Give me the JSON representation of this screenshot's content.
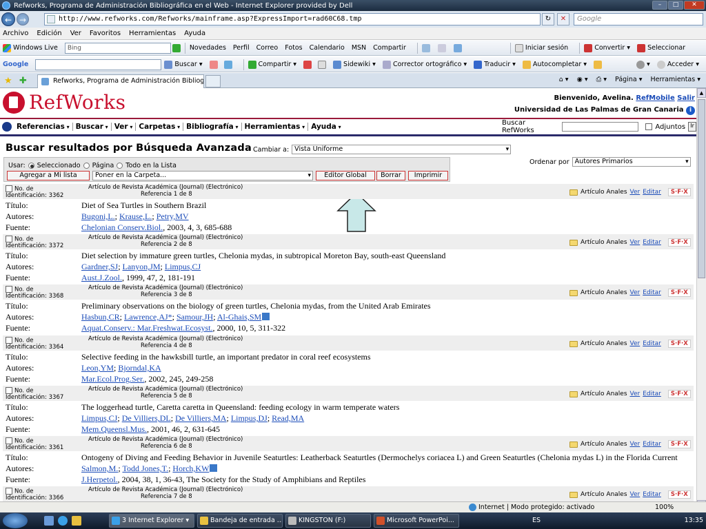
{
  "browser": {
    "title": "Refworks, Programa de Administración Bibliográfica en el Web - Internet Explorer provided by Dell",
    "url": "http://www.refworks.com/Refworks/mainframe.asp?ExpressImport=rad60C68.tmp",
    "search_placeholder": "Google",
    "menu": [
      "Archivo",
      "Edición",
      "Ver",
      "Favoritos",
      "Herramientas",
      "Ayuda"
    ],
    "toolbar1": {
      "windows_live": "Windows Live",
      "bing_value": "Bing",
      "links": [
        "Novedades",
        "Perfil",
        "Correo",
        "Fotos",
        "Calendario",
        "MSN",
        "Compartir"
      ],
      "iniciar": "Iniciar sesión",
      "convertir": "Convertir",
      "seleccionar": "Seleccionar"
    },
    "toolbar2": {
      "google": "Google",
      "buscar": "Buscar",
      "compartir": "Compartir",
      "sidewiki": "Sidewiki",
      "corrector": "Corrector ortográfico",
      "traducir": "Traducir",
      "autocompletar": "Autocompletar",
      "acceder": "Acceder"
    },
    "tab_title": "Refworks, Programa de Administración Bibliográf...",
    "tab_tools": {
      "pagina": "Página",
      "herramientas": "Herramientas"
    }
  },
  "app": {
    "logo": "RefWorks",
    "welcome": "Bienvenido, Avelina.",
    "refmobile": "RefMobile",
    "salir": "Salir",
    "university": "Universidad de Las Palmas de Gran Canaria",
    "menu": [
      "Referencias",
      "Buscar",
      "Ver",
      "Carpetas",
      "Bibliografía",
      "Herramientas",
      "Ayuda"
    ],
    "search_label": "Buscar RefWorks",
    "adjuntos": "Adjuntos",
    "heading": "Buscar resultados por Búsqueda Avanzada",
    "cambiar_label": "Cambiar a:",
    "cambiar_value": "Vista Uniforme",
    "usar_label": "Usar:",
    "usar_options": [
      "Seleccionado",
      "Página",
      "Todo en la Lista"
    ],
    "btn_agregar": "Agregar a Mi lista",
    "carpeta_select": "Poner en la Carpeta...",
    "btn_editor": "Editor Global",
    "btn_borrar": "Borrar",
    "btn_imprimir": "Imprimir",
    "ordenar_label": "Ordenar por",
    "ordenar_value": "Autores Primarios",
    "labels": {
      "titulo": "Título:",
      "autores": "Autores:",
      "fuente": "Fuente:"
    },
    "folder_label": "Artículo Anales",
    "ver": "Ver",
    "editar": "Editar",
    "sfx": "S·F·X"
  },
  "records": [
    {
      "id_label": "No. de Identificación: 3362",
      "type": "Artículo de Revista Académica (Journal) (Electrónico)",
      "ref": "Referencia 1 de 8",
      "title": "Diet of Sea Turtles in Southern Brazil",
      "authors": [
        "Bugoni,L.",
        "Krause,L.",
        "Petry,MV"
      ],
      "source_link": "Chelonian Conserv.Biol.",
      "source_rest": ", 2003, 4, 3, 685-688"
    },
    {
      "id_label": "No. de Identificación: 3372",
      "type": "Artículo de Revista Académica (Journal) (Electrónico)",
      "ref": "Referencia 2 de 8",
      "title": "Diet selection by immature green turtles, Chelonia mydas, in subtropical Moreton Bay, south-east Queensland",
      "authors": [
        "Gardner,SJ",
        "Lanyon,JM",
        "Limpus,CJ"
      ],
      "source_link": "Aust.J.Zool.",
      "source_rest": ", 1999, 47, 2, 181-191"
    },
    {
      "id_label": "No. de Identificación: 3368",
      "type": "Artículo de Revista Académica (Journal) (Electrónico)",
      "ref": "Referencia 3 de 8",
      "title": "Preliminary observations on the biology of green turtles, Chelonia mydas, from the United Arab Emirates",
      "authors": [
        "Hasbun,CR",
        "Lawrence,AJ*",
        "Samour,JH",
        "Al-Ghais,SM"
      ],
      "source_link": "Aquat.Conserv.: Mar.Freshwat.Ecosyst.",
      "source_rest": ", 2000, 10, 5, 311-322"
    },
    {
      "id_label": "No. de Identificación: 3364",
      "type": "Artículo de Revista Académica (Journal) (Electrónico)",
      "ref": "Referencia 4 de 8",
      "title": "Selective feeding in the hawksbill turtle, an important predator in coral reef ecosystems",
      "authors": [
        "Leon,YM",
        "Bjorndal,KA"
      ],
      "source_link": "Mar.Ecol.Prog.Ser.",
      "source_rest": ", 2002, 245, 249-258"
    },
    {
      "id_label": "No. de Identificación: 3367",
      "type": "Artículo de Revista Académica (Journal) (Electrónico)",
      "ref": "Referencia 5 de 8",
      "title": "The loggerhead turtle, Caretta caretta in Queensland: feeding ecology in warm temperate waters",
      "authors": [
        "Limpus,CJ",
        "De Villiers,DL",
        "De Villiers,MA",
        "Limpus,DJ",
        "Read,MA"
      ],
      "source_link": "Mem.Queensl.Mus.",
      "source_rest": ", 2001, 46, 2, 631-645"
    },
    {
      "id_label": "No. de Identificación: 3361",
      "type": "Artículo de Revista Académica (Journal) (Electrónico)",
      "ref": "Referencia 6 de 8",
      "title": "Ontogeny of Diving and Feeding Behavior in Juvenile Seaturtles: Leatherback Seaturtles (Dermochelys coriacea L) and Green Seaturtles (Chelonia mydas L) in the Florida Current",
      "authors": [
        "Salmon,M.",
        "Todd Jones,T.",
        "Horch,KW"
      ],
      "source_link": "J.Herpetol.",
      "source_rest": ", 2004, 38, 1, 36-43, The Society for the Study of Amphibians and Reptiles"
    },
    {
      "id_label": "No. de Identificación: 3366",
      "type": "Artículo de Revista Académica (Journal) (Electrónico)",
      "ref": "Referencia 7 de 8"
    }
  ],
  "status": {
    "zone": "Internet | Modo protegido: activado",
    "zoom": "100%"
  },
  "taskbar": {
    "items": [
      "3 Internet Explorer",
      "Bandeja de entrada ...",
      "KINGSTON (F:)",
      "Microsoft PowerPoi..."
    ],
    "lang": "ES",
    "time": "13:35"
  }
}
